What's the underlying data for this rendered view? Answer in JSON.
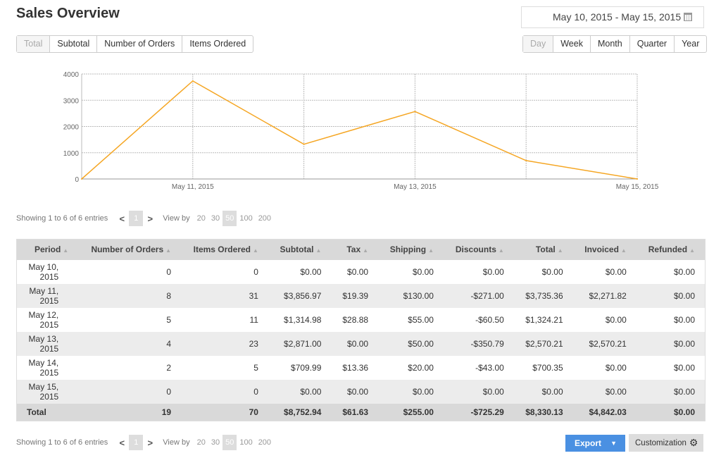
{
  "header": {
    "title": "Sales Overview",
    "date_range": "May 10, 2015 - May 15, 2015",
    "calendar_icon": "calendar-icon"
  },
  "metric_tabs": [
    {
      "label": "Total",
      "active": true
    },
    {
      "label": "Subtotal",
      "active": false
    },
    {
      "label": "Number of Orders",
      "active": false
    },
    {
      "label": "Items Ordered",
      "active": false
    }
  ],
  "period_tabs": [
    {
      "label": "Day",
      "active": true
    },
    {
      "label": "Week",
      "active": false
    },
    {
      "label": "Month",
      "active": false
    },
    {
      "label": "Quarter",
      "active": false
    },
    {
      "label": "Year",
      "active": false
    }
  ],
  "chart_data": {
    "type": "line",
    "title": "",
    "xlabel": "",
    "ylabel": "",
    "x": [
      "May 10, 2015",
      "May 11, 2015",
      "May 12, 2015",
      "May 13, 2015",
      "May 14, 2015",
      "May 15, 2015"
    ],
    "x_tick_labels": [
      "May 11, 2015",
      "May 13, 2015",
      "May 15, 2015"
    ],
    "y_ticks": [
      0,
      1000,
      2000,
      3000,
      4000
    ],
    "ylim": [
      0,
      4000
    ],
    "grid": true,
    "series": [
      {
        "name": "Total",
        "color": "#f5a623",
        "values": [
          0,
          3735.36,
          1324.21,
          2570.21,
          700.35,
          0
        ]
      }
    ]
  },
  "pager": {
    "info": "Showing 1 to 6 of 6 entries",
    "prev": "<",
    "next": ">",
    "current_page": "1",
    "view_by_label": "View by",
    "view_by_options": [
      "20",
      "30",
      "50",
      "100",
      "200"
    ],
    "view_by_selected": "50"
  },
  "table": {
    "columns": [
      "Period",
      "Number of Orders",
      "Items Ordered",
      "Subtotal",
      "Tax",
      "Shipping",
      "Discounts",
      "Total",
      "Invoiced",
      "Refunded"
    ],
    "rows": [
      {
        "period": [
          "May 10,",
          "2015"
        ],
        "cells": [
          "0",
          "0",
          "$0.00",
          "$0.00",
          "$0.00",
          "$0.00",
          "$0.00",
          "$0.00",
          "$0.00"
        ]
      },
      {
        "period": [
          "May 11,",
          "2015"
        ],
        "cells": [
          "8",
          "31",
          "$3,856.97",
          "$19.39",
          "$130.00",
          "-$271.00",
          "$3,735.36",
          "$2,271.82",
          "$0.00"
        ]
      },
      {
        "period": [
          "May 12,",
          "2015"
        ],
        "cells": [
          "5",
          "11",
          "$1,314.98",
          "$28.88",
          "$55.00",
          "-$60.50",
          "$1,324.21",
          "$0.00",
          "$0.00"
        ]
      },
      {
        "period": [
          "May 13,",
          "2015"
        ],
        "cells": [
          "4",
          "23",
          "$2,871.00",
          "$0.00",
          "$50.00",
          "-$350.79",
          "$2,570.21",
          "$2,570.21",
          "$0.00"
        ]
      },
      {
        "period": [
          "May 14,",
          "2015"
        ],
        "cells": [
          "2",
          "5",
          "$709.99",
          "$13.36",
          "$20.00",
          "-$43.00",
          "$700.35",
          "$0.00",
          "$0.00"
        ]
      },
      {
        "period": [
          "May 15,",
          "2015"
        ],
        "cells": [
          "0",
          "0",
          "$0.00",
          "$0.00",
          "$0.00",
          "$0.00",
          "$0.00",
          "$0.00",
          "$0.00"
        ]
      }
    ],
    "totals": {
      "label": "Total",
      "cells": [
        "19",
        "70",
        "$8,752.94",
        "$61.63",
        "$255.00",
        "-$725.29",
        "$8,330.13",
        "$4,842.03",
        "$0.00"
      ]
    }
  },
  "actions": {
    "export_label": "Export",
    "customization_label": "Customization"
  }
}
